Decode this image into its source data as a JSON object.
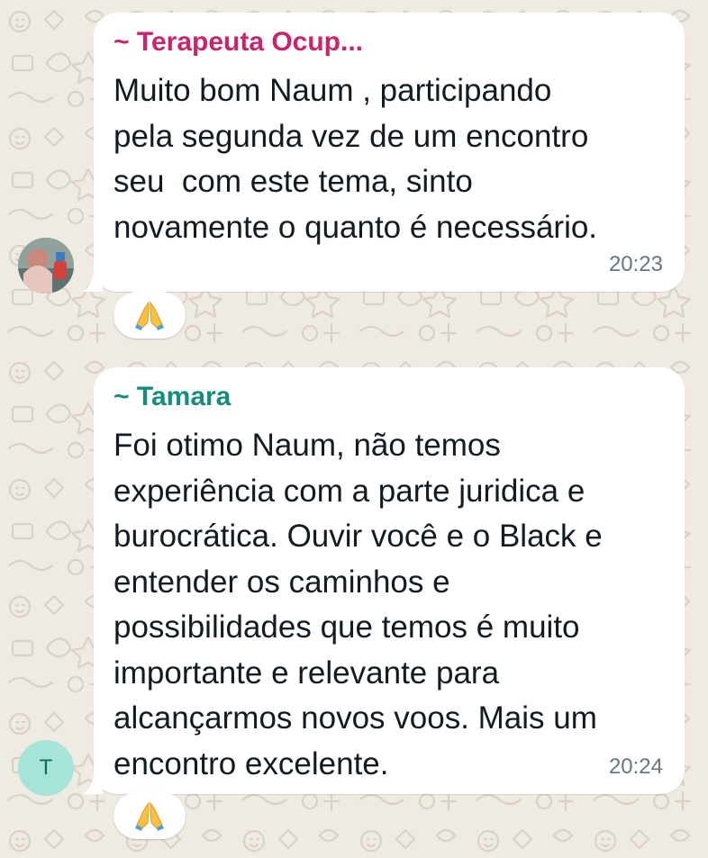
{
  "colors": {
    "chat_background": "#efeae2",
    "bubble": "#ffffff",
    "sender_1": "#c8256d",
    "sender_2": "#168c7a",
    "timestamp": "#667781",
    "avatar_letter_bg": "#a6e4d8"
  },
  "messages": [
    {
      "sender": "~ Terapeuta Ocup...",
      "text": "Muito bom Naum , participando\npela segunda vez de um encontro\nseu  com este tema, sinto\nnovamente o quanto é necessário.",
      "time": "20:23",
      "avatar_type": "photo",
      "reaction_icon": "folded-hands-emoji"
    },
    {
      "sender": "~ Tamara",
      "text": "Foi otimo Naum, não temos\nexperiência com a parte juridica e\nburocrática. Ouvir você e o Black e\nentender os caminhos e\npossibilidades que temos é muito\nimportante e relevante para\nalcançarmos novos voos. Mais um\nencontro excelente.",
      "time": "20:24",
      "avatar_letter": "T",
      "reaction_icon": "folded-hands-emoji"
    }
  ]
}
